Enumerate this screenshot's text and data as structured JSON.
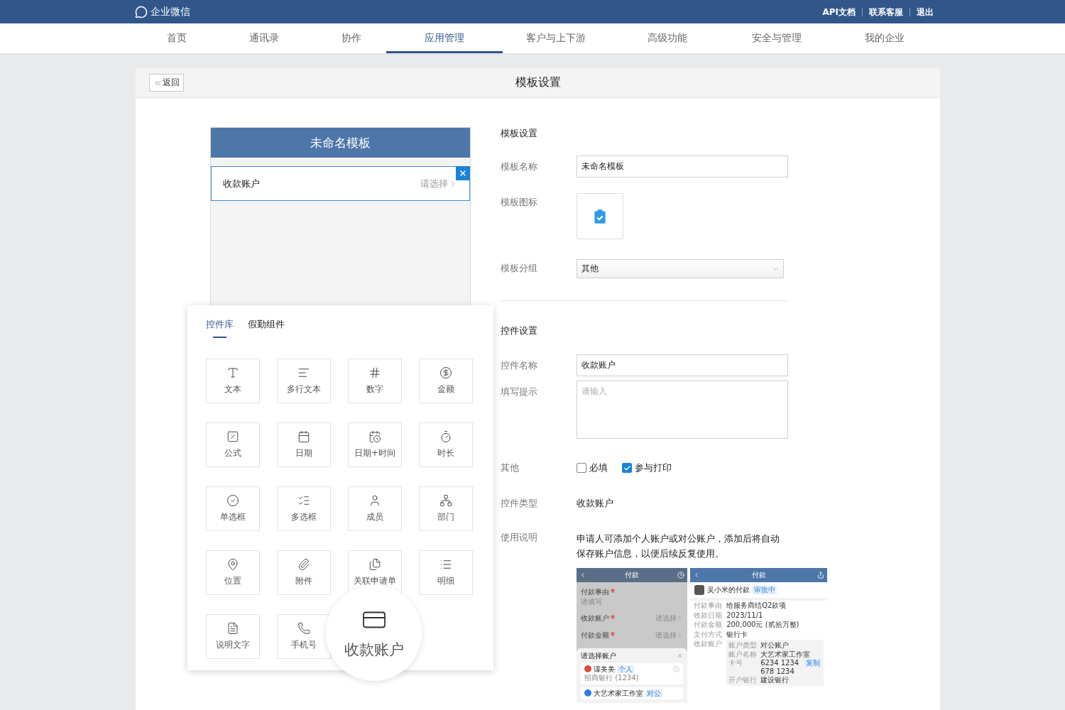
{
  "top_bar": {
    "logo": "企业微信",
    "links": [
      "API文档",
      "联系客服",
      "退出"
    ]
  },
  "nav": [
    {
      "label": "首页",
      "selected": false
    },
    {
      "label": "通讯录",
      "selected": false
    },
    {
      "label": "协作",
      "selected": false
    },
    {
      "label": "应用管理",
      "selected": true
    },
    {
      "label": "客户与上下游",
      "selected": false
    },
    {
      "label": "高级功能",
      "selected": false
    },
    {
      "label": "安全与管理",
      "selected": false
    },
    {
      "label": "我的企业",
      "selected": false
    }
  ],
  "page": {
    "back": "返回",
    "title": "模板设置"
  },
  "preview": {
    "title": "未命名模板",
    "field": {
      "label": "收款账户",
      "placeholder": "请选择"
    }
  },
  "control_panel": {
    "tabs": [
      {
        "label": "控件库",
        "selected": true
      },
      {
        "label": "假勤组件",
        "selected": false
      }
    ],
    "controls": [
      "文本",
      "多行文本",
      "数字",
      "金额",
      "公式",
      "日期",
      "日期+时间",
      "时长",
      "单选框",
      "多选框",
      "成员",
      "部门",
      "位置",
      "附件",
      "关联申请单",
      "明细",
      "说明文字",
      "手机号"
    ],
    "magnified": "收款账户"
  },
  "template_settings": {
    "heading": "模板设置",
    "name": {
      "label": "模板名称",
      "value": "未命名模板"
    },
    "icon": {
      "label": "模板图标"
    },
    "group": {
      "label": "模板分组",
      "value": "其他"
    }
  },
  "control_settings": {
    "heading": "控件设置",
    "name": {
      "label": "控件名称",
      "value": "收款账户"
    },
    "hint": {
      "label": "填写提示",
      "placeholder": "请输入"
    },
    "other": {
      "label": "其他",
      "options": [
        {
          "label": "必填",
          "checked": false
        },
        {
          "label": "参与打印",
          "checked": true
        }
      ]
    },
    "type": {
      "label": "控件类型",
      "value": "收款账户"
    },
    "usage": {
      "label": "使用说明",
      "text": "申请人可添加个人账户或对公账户，添加后将自动保存账户信息，以便后续反复使用。"
    }
  },
  "examples": {
    "form": {
      "title": "付款",
      "fields": [
        {
          "label": "付款事由",
          "required": true,
          "hint": "请填写"
        },
        {
          "label": "收款账户",
          "required": true,
          "placeholder": "请选择"
        },
        {
          "label": "付款金额",
          "required": true,
          "placeholder": "请选择"
        }
      ],
      "sheet": {
        "title": "请选择账户",
        "accounts": [
          {
            "name": "谭美美",
            "tag": "个人",
            "detail": "招商银行 (1234)"
          },
          {
            "name": "大艺术家工作室",
            "tag": "对公"
          }
        ]
      }
    },
    "detail": {
      "title": "付款",
      "applicant": "吴小米的付款",
      "status": "审批中",
      "rows": [
        {
          "label": "付款事由",
          "value": "给服务商结Q2款项"
        },
        {
          "label": "收款日期",
          "value": "2023/11/1"
        },
        {
          "label": "付款金额",
          "value": "200,000元 (贰拾万整)"
        },
        {
          "label": "支付方式",
          "value": "银行卡"
        }
      ],
      "account": {
        "label": "收款账户",
        "rows": [
          {
            "label": "账户类型",
            "value": "对公账户"
          },
          {
            "label": "账户名称",
            "value": "大艺术家工作室"
          },
          {
            "label": "卡号",
            "value": "6234 1234 678 1234",
            "tag": "复制"
          },
          {
            "label": "开户银行",
            "value": "建设银行"
          }
        ]
      }
    }
  }
}
